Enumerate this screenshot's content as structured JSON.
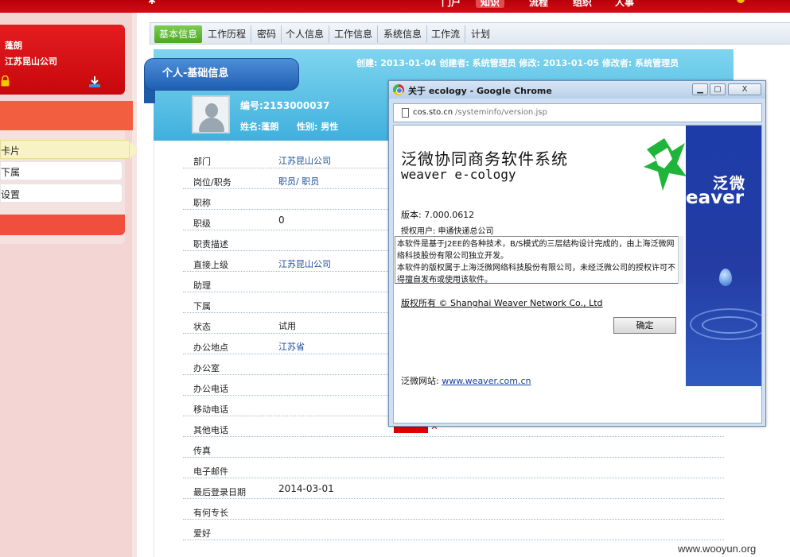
{
  "topbar": {
    "nav": [
      {
        "label": "门户",
        "active": false
      },
      {
        "label": "知识",
        "active": true
      },
      {
        "label": "流程",
        "active": false
      },
      {
        "label": "组织",
        "active": false
      },
      {
        "label": "人事",
        "active": false
      }
    ]
  },
  "user": {
    "name": "蓬朗",
    "company": "江苏昆山公司"
  },
  "left_menu": {
    "items": [
      {
        "label": "卡片",
        "selected": true
      },
      {
        "label": "下属",
        "selected": false
      },
      {
        "label": "设置",
        "selected": false
      }
    ]
  },
  "tabs": [
    {
      "label": "基本信息",
      "active": true
    },
    {
      "label": "工作历程",
      "active": false
    },
    {
      "label": "密码",
      "active": false
    },
    {
      "label": "个人信息",
      "active": false
    },
    {
      "label": "工作信息",
      "active": false
    },
    {
      "label": "系统信息",
      "active": false
    },
    {
      "label": "工作流",
      "active": false
    },
    {
      "label": "计划",
      "active": false
    }
  ],
  "section": {
    "title": "个人-基础信息",
    "meta": "创建: 2013-01-04  创建者: 系统管理员  修改: 2013-01-05  修改者: 系统管理员"
  },
  "employee": {
    "number": "编号:2153000037",
    "name": "姓名:蓬朗",
    "sex": "性别: 男性"
  },
  "fields": [
    {
      "label": "部门",
      "value": "江苏昆山公司",
      "link": true
    },
    {
      "label": "岗位/职务",
      "value": "职员/ 职员",
      "link": true
    },
    {
      "label": "职称",
      "value": "",
      "link": false
    },
    {
      "label": "职级",
      "value": "0",
      "link": false
    },
    {
      "label": "职责描述",
      "value": "",
      "link": false
    },
    {
      "label": "直接上级",
      "value": "江苏昆山公司",
      "link": true
    },
    {
      "label": "助理",
      "value": "",
      "link": false
    },
    {
      "label": "下属",
      "value": "",
      "link": false
    },
    {
      "label": "状态",
      "value": "试用",
      "link": false
    },
    {
      "label": "办公地点",
      "value": "江苏省",
      "link": true
    },
    {
      "label": "办公室",
      "value": "",
      "link": false
    },
    {
      "label": "办公电话",
      "value": "",
      "link": false
    },
    {
      "label": "移动电话",
      "value": "",
      "link": false
    },
    {
      "label": "其他电话",
      "value": "",
      "link": false
    },
    {
      "label": "传真",
      "value": "",
      "link": false
    },
    {
      "label": "电子邮件",
      "value": "",
      "link": false
    },
    {
      "label": "最后登录日期",
      "value": "2014-03-01",
      "link": false
    },
    {
      "label": "有何专长",
      "value": "",
      "link": false
    },
    {
      "label": "爱好",
      "value": "",
      "link": false
    }
  ],
  "dialog": {
    "title": "关于  ecology - Google Chrome",
    "address_host": "cos.sto.cn",
    "address_path": "/systeminfo/version.jsp",
    "product_cn": "泛微协同商务软件系统",
    "product_en": "weaver e-cology",
    "version": "版本: 7.000.0612",
    "licensee": "授权用户: 申通快递总公司",
    "notice_1": "本软件是基于J2EE的各种技术，B/S模式的三层结构设计完成的，由上海泛微网络科技股份有限公司独立开发。",
    "notice_2": "本软件的版权属于上海泛微网络科技股份有限公司，未经泛微公司的授权许可不得擅自发布或使用该软件。",
    "copyright": "版权所有  ©  Shanghai Weaver Network Co., Ltd",
    "ok_label": "确定",
    "website_label": "泛微网站: ",
    "website_url": "www.weaver.com.cn",
    "logo_cn": "泛微",
    "logo_en": "eaver",
    "btn_min": "▁",
    "btn_max": "▢",
    "btn_close": "X"
  },
  "watermark": "www.wooyun.org",
  "colors": {
    "top_red": "#c7070d",
    "tab_active": "#4ba723",
    "header_blue": "#3fb0dd",
    "brand_blue": "#243ca4",
    "link_blue": "#1c4f9c"
  },
  "icons": [
    "lock-icon",
    "download-icon",
    "chrome-icon",
    "document-icon",
    "weaver-logo-icon",
    "avatar-icon",
    "close-x-icon"
  ]
}
